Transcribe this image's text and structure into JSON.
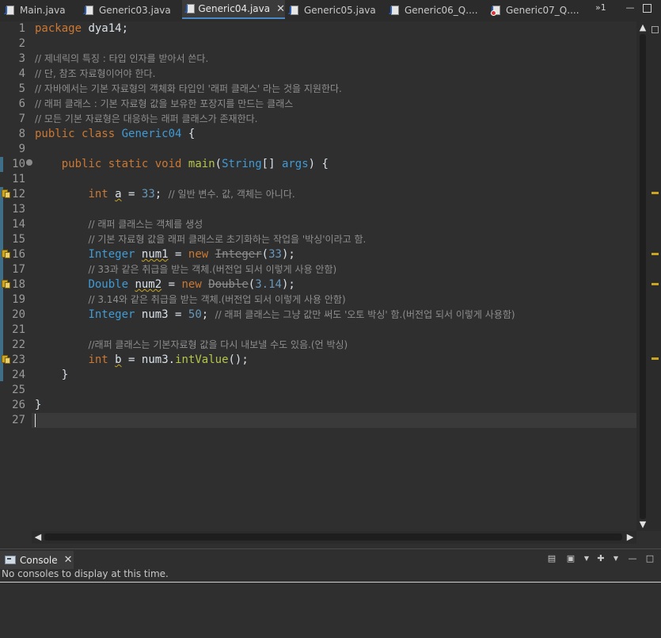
{
  "editor_tabs": [
    {
      "label": "Main.java",
      "active": false,
      "error": false
    },
    {
      "label": "Generic03.java",
      "active": false,
      "error": false
    },
    {
      "label": "Generic04.java",
      "active": true,
      "error": false
    },
    {
      "label": "Generic05.java",
      "active": false,
      "error": false
    },
    {
      "label": "Generic06_Q....",
      "active": false,
      "error": false
    },
    {
      "label": "Generic07_Q....",
      "active": false,
      "error": true
    }
  ],
  "tab_overflow": "»1",
  "code_lines": [
    "1",
    "2",
    "3",
    "4",
    "5",
    "6",
    "7",
    "8",
    "9",
    "10",
    "11",
    "12",
    "13",
    "14",
    "15",
    "16",
    "17",
    "18",
    "19",
    "20",
    "21",
    "22",
    "23",
    "24",
    "25",
    "26",
    "27"
  ],
  "code": {
    "l1_kw": "package",
    "l1_rest": " dya14;",
    "l3": "// 제네릭의 특징 : 타입 인자를 받아서 쓴다.",
    "l4": "// 단, 참조 자료형이어야 한다.",
    "l5": "// 자바에서는 기본 자료형의 객체화 타입인 '래퍼 클래스' 라는 것을 지원한다.",
    "l6": "// 래퍼 클래스 : 기본 자료형 값을 보유한 포장지를 만드는 클래스",
    "l7": "// 모든 기본 자료형은 대응하는 래퍼 클래스가 존재한다.",
    "l8_kw1": "public",
    "l8_kw2": "class",
    "l8_name": "Generic04",
    "l8_rest": " {",
    "l10_kw1": "public",
    "l10_kw2": "static",
    "l10_kw3": "void",
    "l10_fn": "main",
    "l10_p1": "(",
    "l10_type": "String",
    "l10_p2": "[] ",
    "l10_arg": "args",
    "l10_p3": ") {",
    "l12_kw": "int",
    "l12_var": "a",
    "l12_eq": " = ",
    "l12_num": "33",
    "l12_semi": ";",
    "l12_cm": "// 일반 변수. 값, 객체는 아니다.",
    "l14": "// 래퍼 클래스는 객체를 생성",
    "l15": "// 기본 자료형 값을 래퍼 클래스로 초기화하는 작업을 '박싱'이라고 함.",
    "l16_type": "Integer",
    "l16_var": "num1",
    "l16_eq": " = ",
    "l16_kw": "new",
    "l16_ctor": "Integer",
    "l16_p1": "(",
    "l16_num": "33",
    "l16_p2": ");",
    "l17": "// 33과 같은 취급을 받는 객체.(버전업 되서 이렇게 사용 안함)",
    "l18_type": "Double",
    "l18_var": "num2",
    "l18_eq": " = ",
    "l18_kw": "new",
    "l18_ctor": "Double",
    "l18_p1": "(",
    "l18_num": "3.14",
    "l18_p2": ");",
    "l19": "// 3.14와 같은 취급을 받는 객체.(버전업 되서 이렇게 사용 안함)",
    "l20_type": "Integer",
    "l20_var": "num3",
    "l20_eq": " = ",
    "l20_num": "50",
    "l20_semi": ";",
    "l20_cm": "// 래퍼 클래스는 그냥 값만 써도 '오토 박싱' 함.(버전업 되서 이렇게 사용함)",
    "l22": "//래퍼 클래스는 기본자료형 값을 다시 내보낼 수도 있음.(언 박싱)",
    "l23_kw": "int",
    "l23_var": "b",
    "l23_eq": " = ",
    "l23_obj": "num3.",
    "l23_fn": "intValue",
    "l23_rest": "();",
    "l24": "}",
    "l26": "}"
  },
  "console": {
    "tab_label": "Console",
    "message": "No consoles to display at this time."
  },
  "colors": {
    "keyword": "#cc7832",
    "type": "#3f9bd6",
    "method": "#b4c54a",
    "number": "#6897bb",
    "comment": "#8e8e8e",
    "warning": "#c9a520",
    "active_tab_underline": "#4a88c7"
  }
}
